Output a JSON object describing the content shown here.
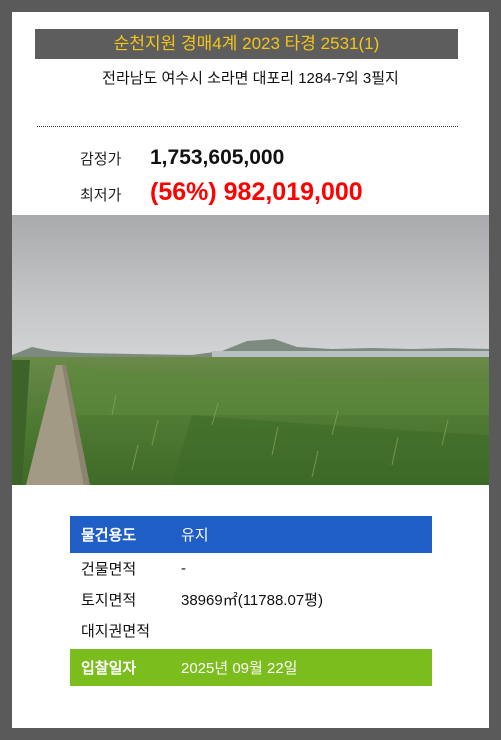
{
  "header": {
    "court_case": "순천지원 경매4계 2023 타경 2531(1)",
    "address": "전라남도 여수시 소라면 대포리 1284-7외 3필지"
  },
  "prices": {
    "appraisal_label": "감정가",
    "appraisal_value": "1,753,605,000",
    "minimum_label": "최저가",
    "minimum_value": "(56%) 982,019,000"
  },
  "details": {
    "usage_label": "물건용도",
    "usage_value": "유지",
    "building_area_label": "건물면적",
    "building_area_value": "-",
    "land_area_label": "토지면적",
    "land_area_value": "38969㎡(11788.07평)",
    "land_right_label": "대지권면적",
    "land_right_value": "",
    "bid_date_label": "입찰일자",
    "bid_date_value": "2025년 09월 22일"
  },
  "colors": {
    "court_text": "#f5c518",
    "minimum_price": "#ff0000",
    "usage_bar": "#1f5ec4",
    "bid_bar": "#7cbd1e"
  }
}
